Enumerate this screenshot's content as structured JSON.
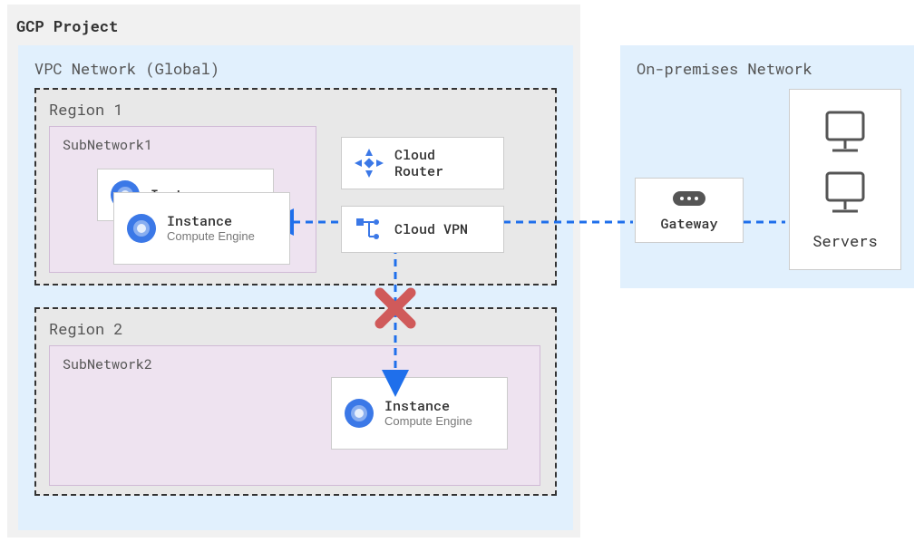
{
  "project": {
    "title": "GCP Project"
  },
  "vpc": {
    "title": "VPC Network (Global)"
  },
  "region1": {
    "title": "Region 1",
    "subnet": {
      "title": "SubNetwork1"
    },
    "instance_back": {
      "title": "Instance"
    },
    "instance_front": {
      "title": "Instance",
      "sub": "Compute Engine"
    },
    "cloud_router": {
      "title": "Cloud Router"
    },
    "cloud_vpn": {
      "title": "Cloud VPN"
    }
  },
  "region2": {
    "title": "Region 2",
    "subnet": {
      "title": "SubNetwork2"
    },
    "instance": {
      "title": "Instance",
      "sub": "Compute Engine"
    }
  },
  "onprem": {
    "title": "On-premises Network",
    "gateway": {
      "title": "Gateway"
    },
    "servers": {
      "title": "Servers"
    }
  }
}
